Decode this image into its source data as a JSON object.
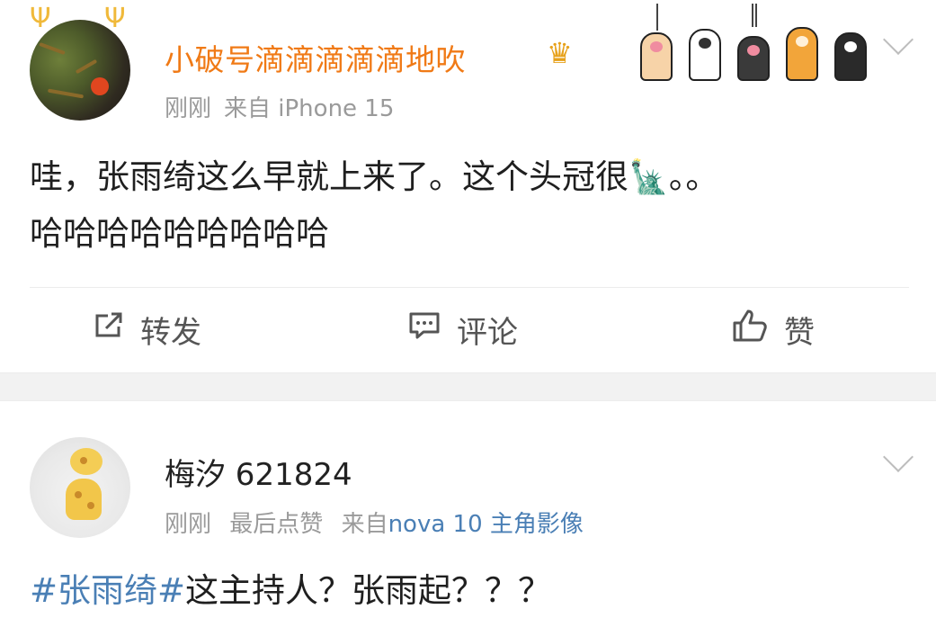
{
  "post1": {
    "username": "小破号滴滴滴滴滴地吹",
    "time": "刚刚",
    "source": "来自 iPhone 15",
    "text_line1": "哇，张雨绮这么早就上来了。这个头冠很",
    "text_after_emoji": "。。",
    "text_line2": "哈哈哈哈哈哈哈哈哈"
  },
  "actions": {
    "forward": "转发",
    "comment": "评论",
    "like": "赞"
  },
  "post2": {
    "username": "梅汐 621824",
    "time": "刚刚",
    "edited": "最后点赞",
    "source_prefix": "来自",
    "device": "nova 10 主角影像",
    "hashtag": "#张雨绮#",
    "text": "这主持人？张雨起？？？"
  },
  "colors": {
    "vip_name": "#f07a16",
    "link_blue": "#4a7fb5",
    "meta_gray": "#9a9a9a"
  },
  "icons": [
    "crown-icon",
    "paw-decoration-icon",
    "chevron-down-icon",
    "share-icon",
    "comment-icon",
    "like-icon",
    "statue-of-liberty-icon"
  ]
}
